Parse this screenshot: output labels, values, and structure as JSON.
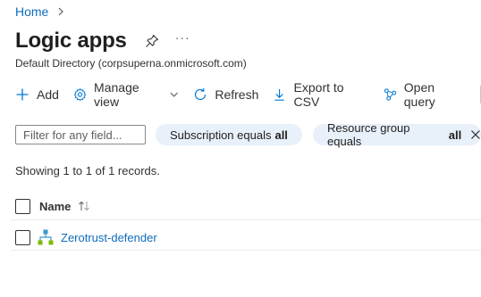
{
  "breadcrumb": {
    "home": "Home"
  },
  "header": {
    "title": "Logic apps",
    "more": "···",
    "subtitle": "Default Directory (corpsuperna.onmicrosoft.com)"
  },
  "toolbar": {
    "add": "Add",
    "manage_view": "Manage view",
    "refresh": "Refresh",
    "export_csv": "Export to CSV",
    "open_query": "Open query"
  },
  "filters": {
    "search_placeholder": "Filter for any field...",
    "subscription": {
      "label": "Subscription equals",
      "value": "all"
    },
    "resource_group": {
      "label": "Resource group equals",
      "value": "all"
    }
  },
  "records_text": "Showing 1 to 1 of 1 records.",
  "table": {
    "columns": [
      "Name"
    ],
    "rows": [
      {
        "name": "Zerotrust-defender"
      }
    ]
  },
  "colors": {
    "link": "#0f6cbd",
    "pill_bg": "#e8f0fa",
    "accent": "#0078d4"
  }
}
